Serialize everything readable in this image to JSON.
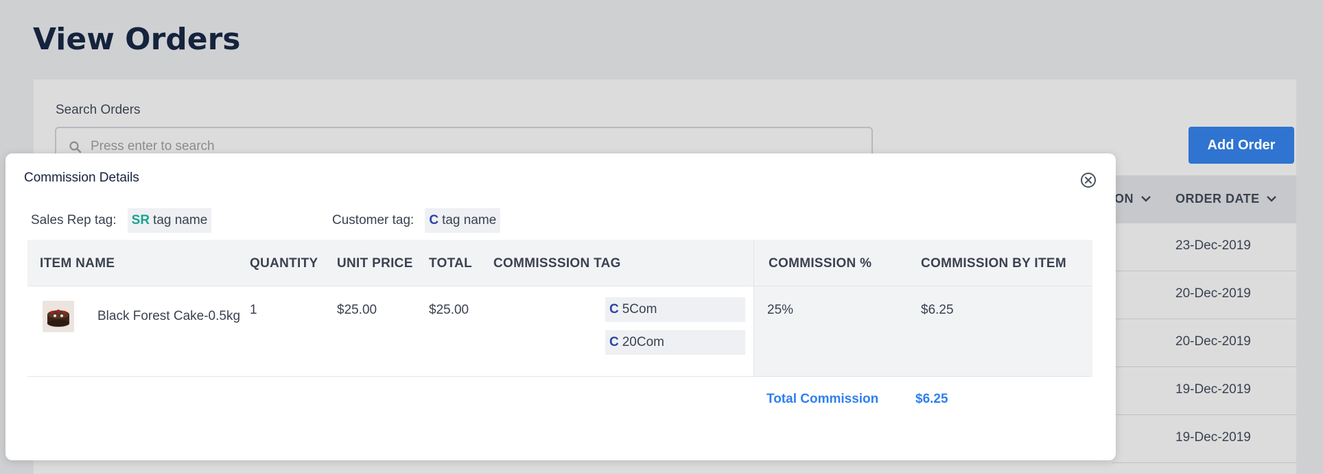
{
  "page": {
    "title": "View Orders"
  },
  "search": {
    "label": "Search Orders",
    "placeholder": "Press enter to search"
  },
  "toolbar": {
    "add_order_label": "Add Order"
  },
  "background_table": {
    "columns": [
      {
        "label": "ON",
        "icon": "chevron-down-icon"
      },
      {
        "label": "ORDER DATE",
        "icon": "chevron-down-icon"
      }
    ],
    "rows": [
      {
        "order_date": "23-Dec-2019"
      },
      {
        "order_date": "20-Dec-2019"
      },
      {
        "order_date": "20-Dec-2019"
      },
      {
        "order_date": "19-Dec-2019"
      },
      {
        "order_date": "19-Dec-2019"
      }
    ]
  },
  "modal": {
    "title": "Commission Details",
    "close_icon": "close-circle-icon",
    "sales_rep_tag": {
      "label": "Sales Rep tag:",
      "prefix": "SR",
      "name": "tag name"
    },
    "customer_tag": {
      "label": "Customer tag:",
      "prefix": "C",
      "name": "tag name"
    },
    "columns": [
      "ITEM NAME",
      "QUANTITY",
      "UNIT PRICE",
      "TOTAL",
      "COMMISSSION TAG",
      "COMMISSION %",
      "COMMISSION BY ITEM"
    ],
    "items": [
      {
        "thumbnail_icon": "cake-image",
        "name": "Black Forest Cake-0.5kg",
        "quantity": "1",
        "unit_price": "$25.00",
        "total": "$25.00",
        "commission_tags": [
          {
            "prefix": "C",
            "name": "5Com"
          },
          {
            "prefix": "C",
            "name": "20Com"
          }
        ],
        "commission_percent": "25%",
        "commission_by_item": "$6.25"
      }
    ],
    "total_commission_label": "Total Commission",
    "total_commission_value": "$6.25"
  },
  "colors": {
    "accent": "#2f74d0",
    "link_blue": "#2f80ed",
    "sr_prefix": "#19a391",
    "c_prefix": "#2b44a8",
    "title": "#15233d"
  }
}
